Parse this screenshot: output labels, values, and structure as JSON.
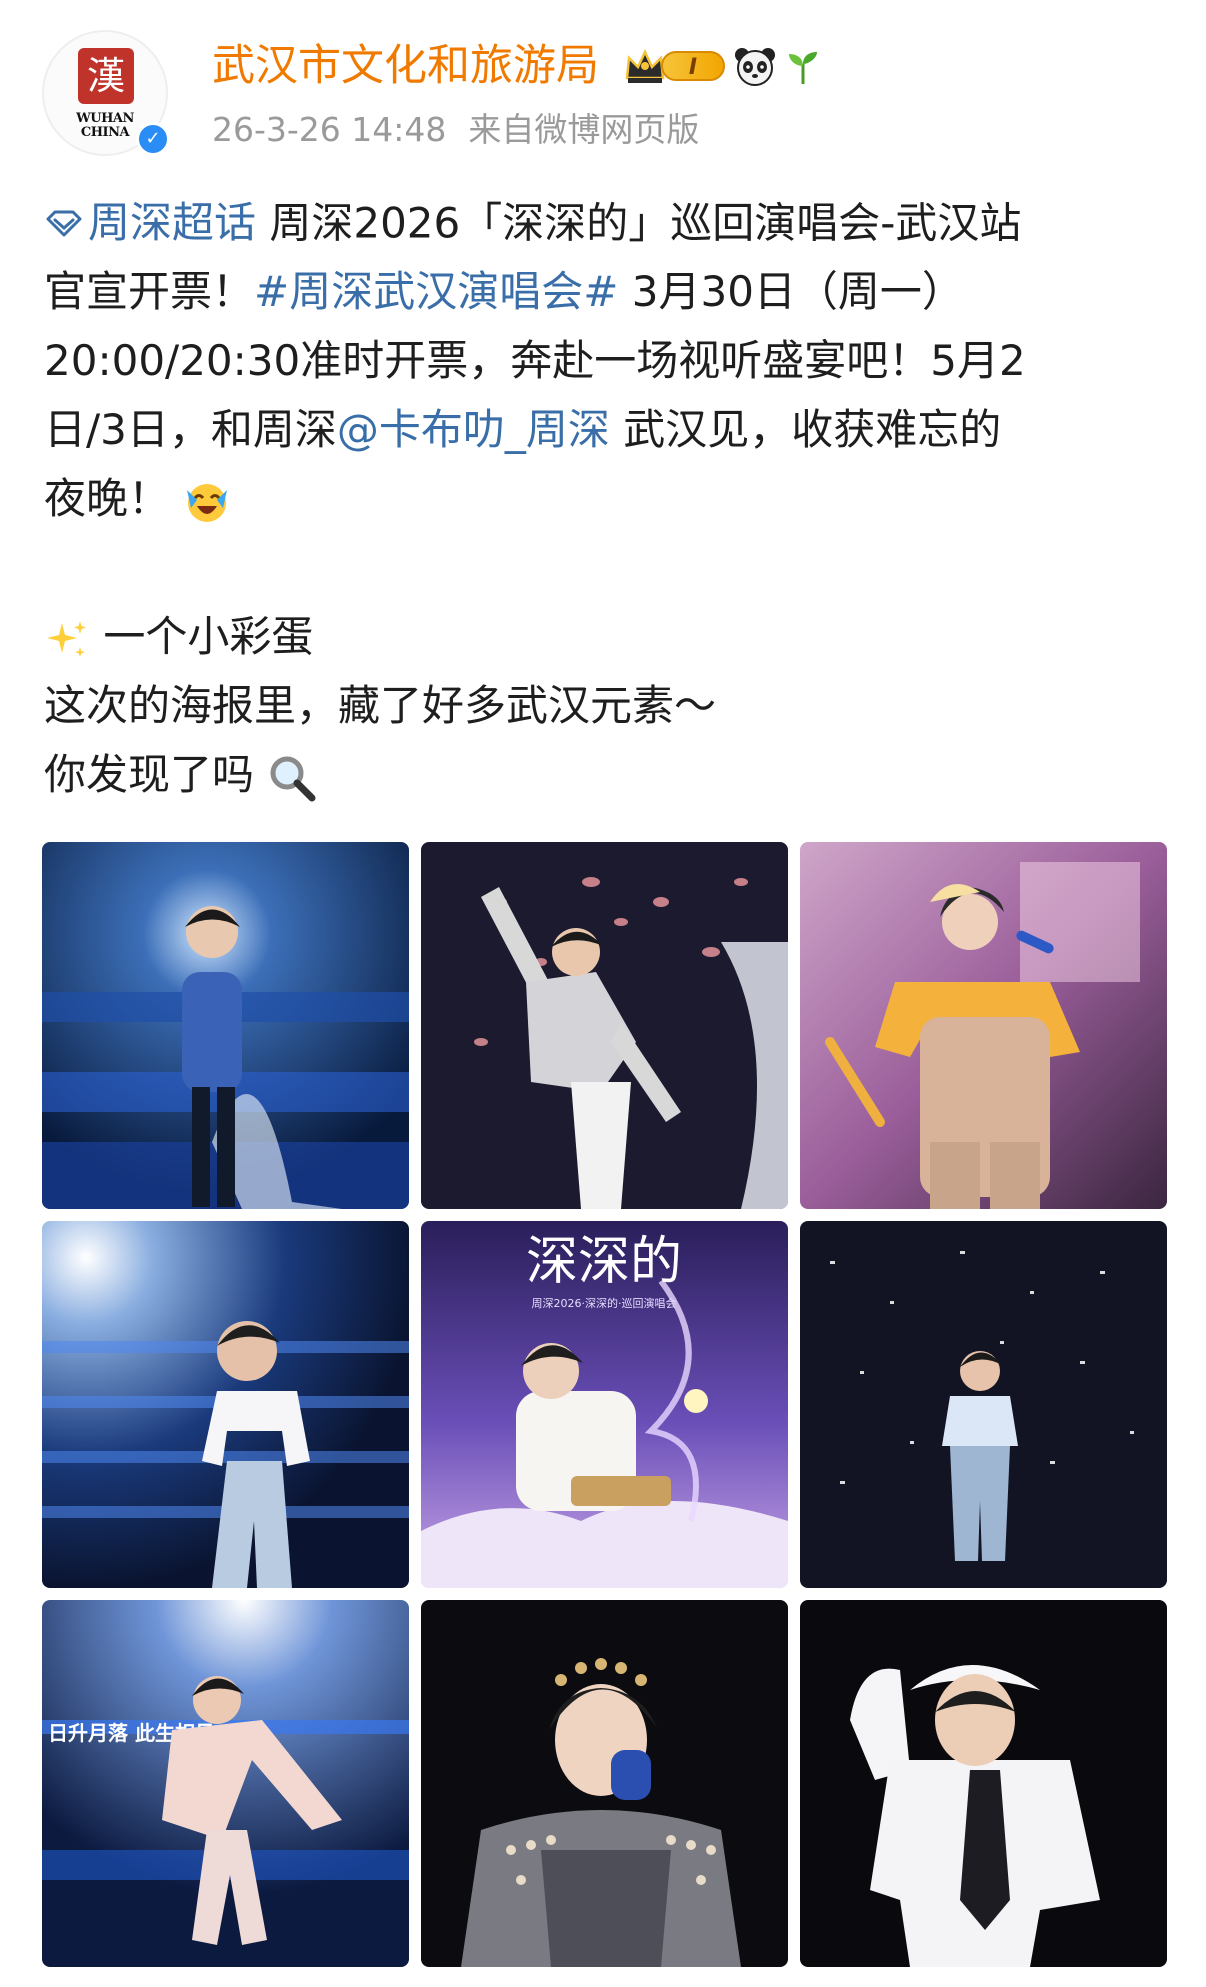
{
  "header": {
    "avatar": {
      "seal_glyph": "漢",
      "logo_line1": "WUHAN",
      "logo_line2": "CHINA",
      "verified_icon": "verified-check-icon"
    },
    "username": "武汉市文化和旅游局",
    "vip_level": "I",
    "badges": [
      "crown-icon",
      "panda-icon",
      "sprout-icon"
    ],
    "timestamp": "26-3-26 14:48",
    "source": "来自微博网页版"
  },
  "post": {
    "line1": {
      "supertopic": "周深超话",
      "text": " 周深2026「深深的」巡回演唱会-武汉站"
    },
    "line2": {
      "prefix": "官宣开票！",
      "hashtag": "#周深武汉演唱会#",
      "suffix": " 3月30日（周一）"
    },
    "line3": "20:00/20:30准时开票，奔赴一场视听盛宴吧！5月2",
    "line4": {
      "prefix": "日/3日，和周深",
      "mention": "@卡布叻_周深",
      "suffix": " 武汉见，收获难忘的"
    },
    "line5": "夜晚！",
    "line6": " 一个小彩蛋",
    "line7": "这次的海报里，藏了好多武汉元素～",
    "line8": "你发现了吗"
  },
  "grid": {
    "count": 9,
    "photo_labels": [
      "日升月落 此生相见",
      "深深的",
      "周深2026·深深的·巡回演唱会"
    ]
  },
  "colors": {
    "username": "#f07a00",
    "link": "#3a6ea8",
    "meta": "#9a9a9a",
    "text": "#1e1e1e",
    "verified": "#2a8cf5"
  }
}
